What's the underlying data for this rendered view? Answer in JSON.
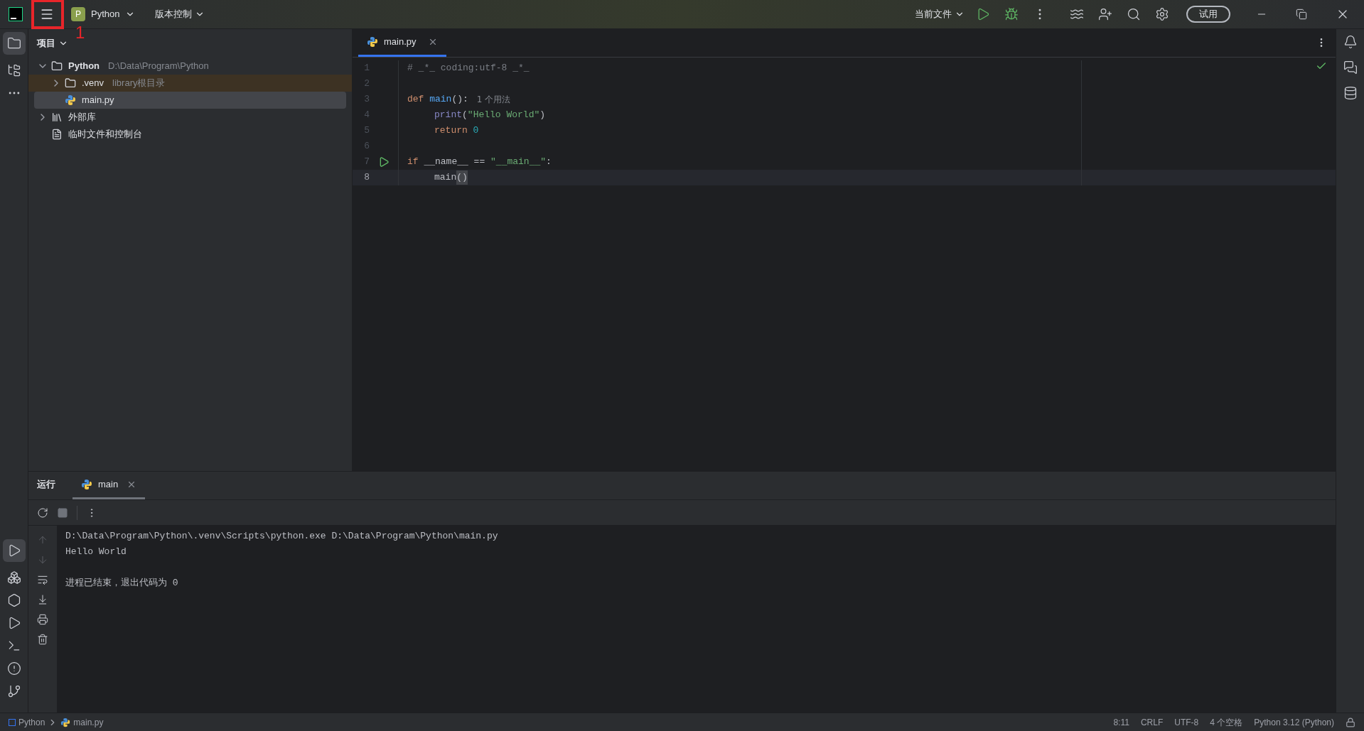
{
  "titlebar": {
    "project": {
      "badge": "P",
      "name": "Python"
    },
    "vcs": "版本控制",
    "run_config": "当前文件",
    "trial": "试用"
  },
  "annotation": {
    "label": "1"
  },
  "project_panel": {
    "title": "项目",
    "tree": [
      {
        "name": "Python",
        "path": "D:\\Data\\Program\\Python",
        "kind": "folder",
        "expanded": true,
        "selected": false,
        "children": [
          {
            "name": ".venv",
            "path": "library根目录",
            "kind": "folder",
            "expanded": false,
            "selected": false,
            "excluded": true
          },
          {
            "name": "main.py",
            "kind": "python",
            "selected": true
          }
        ]
      },
      {
        "name": "外部库",
        "kind": "library",
        "expanded": false,
        "selected": false
      },
      {
        "name": "临时文件和控制台",
        "kind": "scratch",
        "selected": false
      }
    ]
  },
  "editor": {
    "tabs": [
      {
        "label": "main.py",
        "selected": true
      }
    ],
    "lines": [
      {
        "number": "1",
        "current": false,
        "tokens": [
          {
            "text": "# _*_ coding:utf-8 _*_",
            "kind": "comment"
          }
        ]
      },
      {
        "number": "2",
        "current": false
      },
      {
        "number": "3",
        "current": false,
        "tokens": [
          {
            "text": "def ",
            "kind": "keyword"
          },
          {
            "text": "main",
            "kind": "function"
          },
          {
            "text": "():",
            "kind": "plain"
          },
          {
            "text": "1 个用法",
            "kind": "hint"
          }
        ]
      },
      {
        "number": "4",
        "current": false,
        "indent": true,
        "tokens": [
          {
            "text": "print",
            "kind": "builtin"
          },
          {
            "text": "(",
            "kind": "plain"
          },
          {
            "text": "\"Hello World\"",
            "kind": "string"
          },
          {
            "text": ")",
            "kind": "plain"
          }
        ]
      },
      {
        "number": "5",
        "current": false,
        "indent": true,
        "tokens": [
          {
            "text": "return ",
            "kind": "keyword"
          },
          {
            "text": "0",
            "kind": "number"
          }
        ]
      },
      {
        "number": "6",
        "current": false
      },
      {
        "number": "7",
        "current": false,
        "run_marker": true,
        "tokens": [
          {
            "text": "if ",
            "kind": "keyword"
          },
          {
            "text": "__name__ == ",
            "kind": "plain"
          },
          {
            "text": "\"__main__\"",
            "kind": "string"
          },
          {
            "text": ":",
            "kind": "plain"
          }
        ]
      },
      {
        "number": "8",
        "current": true,
        "indent": true,
        "tokens": [
          {
            "text": "main",
            "kind": "plain"
          },
          {
            "text": "()",
            "kind": "match"
          }
        ]
      }
    ]
  },
  "run_panel": {
    "title": "运行",
    "tabs": [
      {
        "label": "main",
        "selected": true
      }
    ],
    "output": [
      {
        "text": "D:\\Data\\Program\\Python\\.venv\\Scripts\\python.exe D:\\Data\\Program\\Python\\main.py"
      },
      {
        "text": "Hello World"
      },
      {
        "text": "进程已结束，退出代码为 0",
        "gap_before": true
      }
    ]
  },
  "status_bar": {
    "breadcrumbs": [
      "Python",
      "main.py"
    ],
    "items": [
      "8:11",
      "CRLF",
      "UTF-8",
      "4 个空格",
      "Python 3.12 (Python)"
    ]
  }
}
